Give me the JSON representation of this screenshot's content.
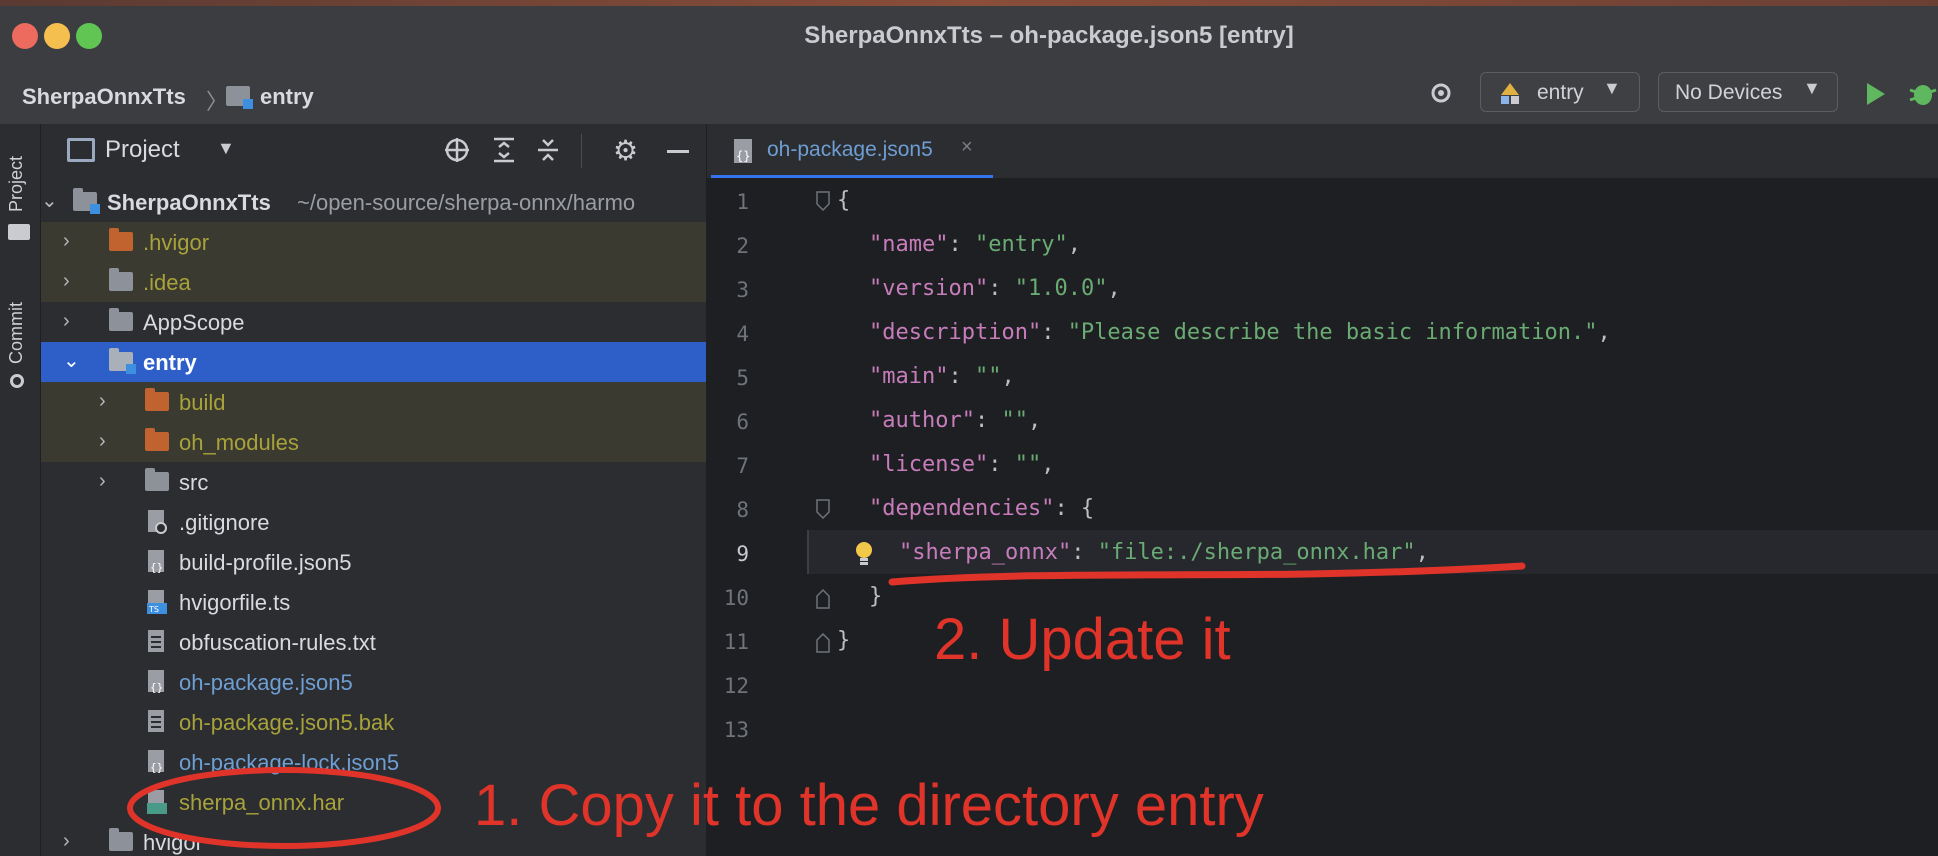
{
  "window": {
    "title": "SherpaOnnxTts – oh-package.json5 [entry]"
  },
  "breadcrumb": {
    "project": "SherpaOnnxTts",
    "module": "entry"
  },
  "toolbar": {
    "run_config": "entry",
    "device": "No Devices"
  },
  "side_strip": {
    "project_label": "Project",
    "commit_label": "Commit"
  },
  "project_panel": {
    "title": "Project",
    "root": {
      "name": "SherpaOnnxTts",
      "path": "~/open-source/sherpa-onnx/harmo"
    },
    "items": [
      {
        "label": ".hvigor"
      },
      {
        "label": ".idea"
      },
      {
        "label": "AppScope"
      },
      {
        "label": "entry"
      },
      {
        "label": "build"
      },
      {
        "label": "oh_modules"
      },
      {
        "label": "src"
      },
      {
        "label": ".gitignore"
      },
      {
        "label": "build-profile.json5"
      },
      {
        "label": "hvigorfile.ts"
      },
      {
        "label": "obfuscation-rules.txt"
      },
      {
        "label": "oh-package.json5"
      },
      {
        "label": "oh-package.json5.bak"
      },
      {
        "label": "oh-package-lock.json5"
      },
      {
        "label": "sherpa_onnx.har"
      },
      {
        "label": "hvigor"
      }
    ]
  },
  "editor": {
    "tab_label": "oh-package.json5",
    "line_numbers": [
      "1",
      "2",
      "3",
      "4",
      "5",
      "6",
      "7",
      "8",
      "9",
      "10",
      "11",
      "12",
      "13"
    ],
    "code": {
      "l2_key": "\"name\"",
      "l2_val": "\"entry\"",
      "l3_key": "\"version\"",
      "l3_val": "\"1.0.0\"",
      "l4_key": "\"description\"",
      "l4_val": "\"Please describe the basic information.\"",
      "l5_key": "\"main\"",
      "l5_val": "\"\"",
      "l6_key": "\"author\"",
      "l6_val": "\"\"",
      "l7_key": "\"license\"",
      "l7_val": "\"\"",
      "l8_key": "\"dependencies\"",
      "l9_key": "\"sherpa_onnx\"",
      "l9_val": "\"file:./sherpa_onnx.har\""
    }
  },
  "annotations": {
    "step1": "1. Copy it to the directory entry",
    "step2": "2. Update it"
  },
  "colors": {
    "annotation": "#e0342a",
    "selection": "#2e5fc9",
    "accent": "#3574f0"
  }
}
